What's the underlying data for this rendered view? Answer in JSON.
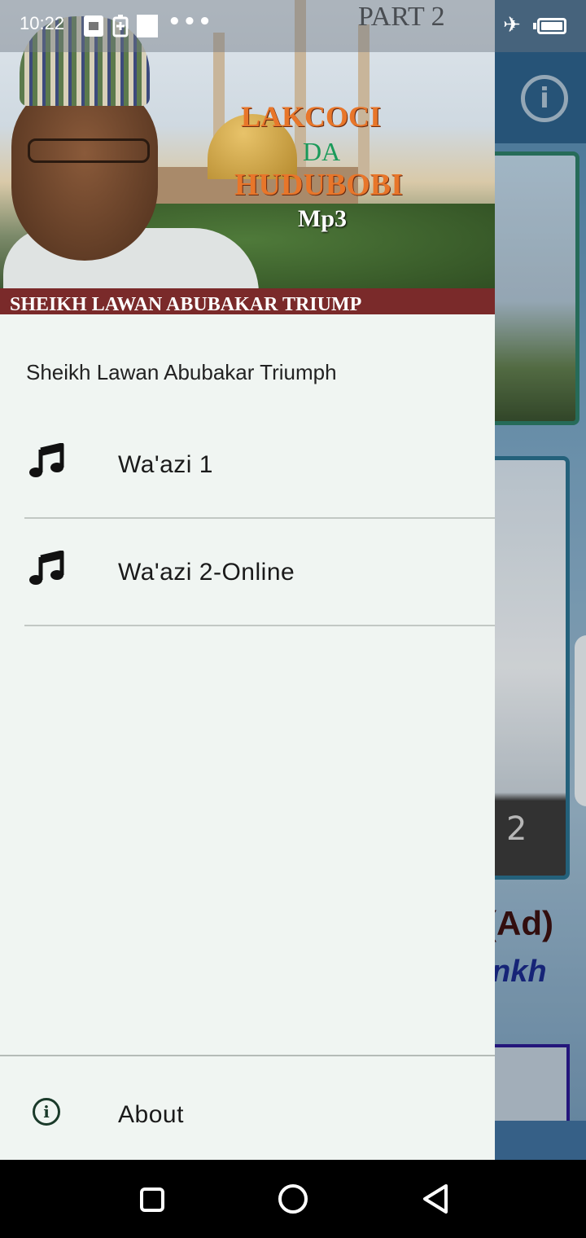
{
  "status_bar": {
    "time": "10:22",
    "icons": [
      "screenshot-icon",
      "battery-saver-icon",
      "notification-square-icon",
      "more-dots-icon",
      "airplane-icon",
      "battery-icon"
    ]
  },
  "background_app": {
    "info_icon": "info-icon",
    "card_number": "2",
    "ad_text": "(Ad)",
    "partial_text": "nkh"
  },
  "drawer": {
    "header": {
      "part_label": "PART 2",
      "title_line1": "LAKCOCI",
      "title_line2": "DA",
      "title_line3": "HUDUBOBI",
      "title_line4": "Mp3",
      "banner": "SHEIKH LAWAN ABUBAKAR TRIUMP"
    },
    "subtitle": "Sheikh Lawan Abubakar Triumph",
    "menu": [
      {
        "label": "Wa'azi 1",
        "icon": "music-note-icon"
      },
      {
        "label": "Wa'azi 2-Online",
        "icon": "music-note-icon"
      }
    ],
    "footer": {
      "label": "About",
      "icon": "info-icon"
    }
  },
  "nav_bar": {
    "icons": [
      "recents-icon",
      "home-icon",
      "back-icon"
    ]
  }
}
